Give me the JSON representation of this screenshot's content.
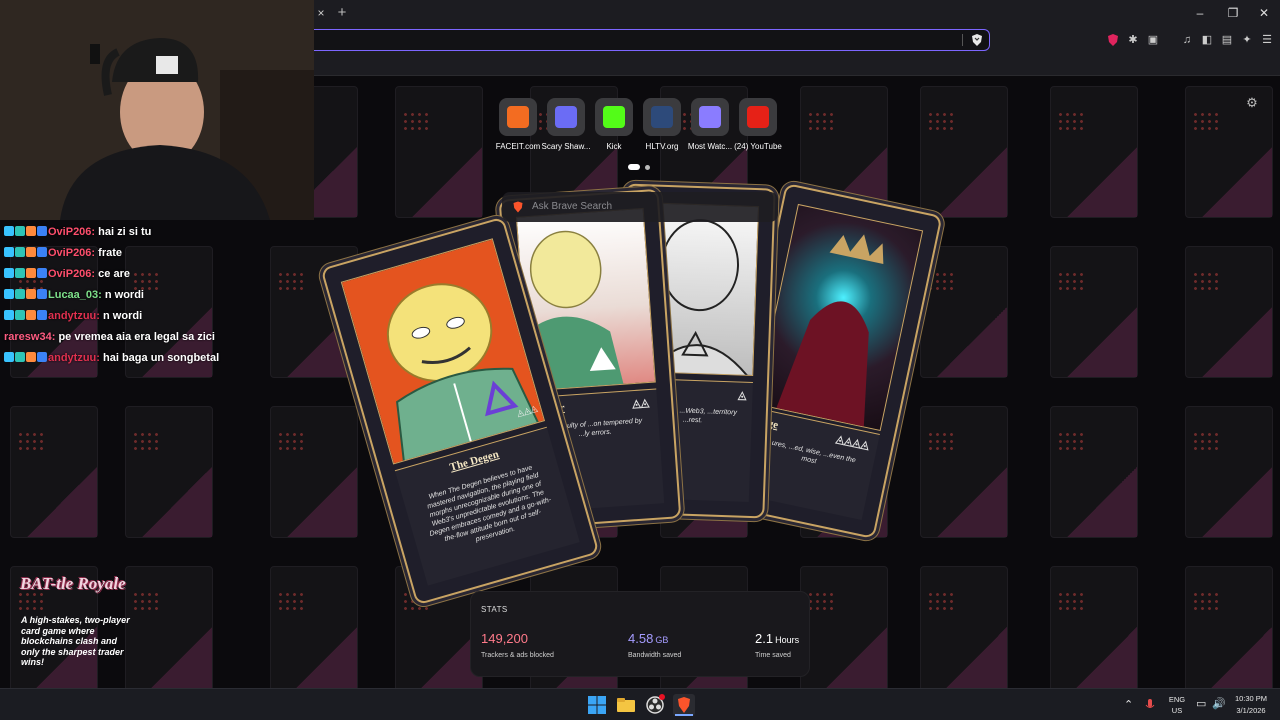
{
  "browser": {
    "tab_close_glyph": "×",
    "new_tab_glyph": "+",
    "window_controls": {
      "minimize": "–",
      "restore": "❐",
      "close": "✕"
    }
  },
  "top_sites": [
    {
      "name": "FACEIT.com",
      "color": "#f36c21"
    },
    {
      "name": "Scary Shaw...",
      "color": "#6b6cf5"
    },
    {
      "name": "Kick",
      "color": "#53fc18"
    },
    {
      "name": "HLTV.org",
      "color": "#2d4a7a"
    },
    {
      "name": "Most Watc...",
      "color": "#8a7cff"
    },
    {
      "name": "(24) YouTube",
      "color": "#e62117"
    }
  ],
  "search": {
    "placeholder": "Ask Brave Search"
  },
  "cards": [
    {
      "name": "The Degen",
      "rank": "◬◬◬",
      "description": "When The Degen believes to have mastered navigation, the playing field morphs unrecognizable during one of Web3's unpredictable evolutions. The Degen embraces comedy and a go-with-the-flow attitude born out of self-preservation.",
      "art_color": "#e4541f"
    },
    {
      "name": "...bler",
      "rank": "◬◬",
      "description": "...difficulty of ...on tempered by ...ly errors."
    },
    {
      "name": "...ous",
      "rank": "◬",
      "description": "...arks on ...Web3, ...territory ...rest."
    },
    {
      "name": "...ge",
      "rank": "◬◬◬◬",
      "description": "...ures, ...ed, wise, ...even the most"
    }
  ],
  "stats": {
    "title": "STATS",
    "trackers": {
      "value": "149,200",
      "label": "Trackers & ads blocked",
      "color": "#ff7a8a"
    },
    "bandwidth": {
      "value": "4.58",
      "unit": "GB",
      "label": "Bandwidth saved",
      "color": "#a59cff"
    },
    "time": {
      "value": "2.1",
      "unit": "Hours",
      "label": "Time saved",
      "color": "#ffffff"
    }
  },
  "chat": [
    {
      "user": "OviP206:",
      "message": "hai zi si tu",
      "color": "#ff4f6d"
    },
    {
      "user": "OviP206:",
      "message": "frate",
      "color": "#ff4f6d"
    },
    {
      "user": "OviP206:",
      "message": "ce are",
      "color": "#ff4f6d"
    },
    {
      "user": "Lucaa_03:",
      "message": "n wordi",
      "color": "#7de08a"
    },
    {
      "user": "andytzuu:",
      "message": "n wordi",
      "color": "#e0304f"
    },
    {
      "user": "raresw34:",
      "message": "pe vremea aia era legal sa zici",
      "color": "#ff5c82"
    },
    {
      "user": "andytzuu:",
      "message": "hai baga un songbetal",
      "color": "#e0304f"
    }
  ],
  "promo": {
    "logo": "BAT-tle Royale",
    "text": "A high-stakes, two-player card game where blockchains clash and only the sharpest trader wins!"
  },
  "taskbar": {
    "language": "ENG",
    "region": "US",
    "time": "10:30 PM",
    "date": "3/1/2026",
    "tray_up_glyph": "⌃"
  }
}
